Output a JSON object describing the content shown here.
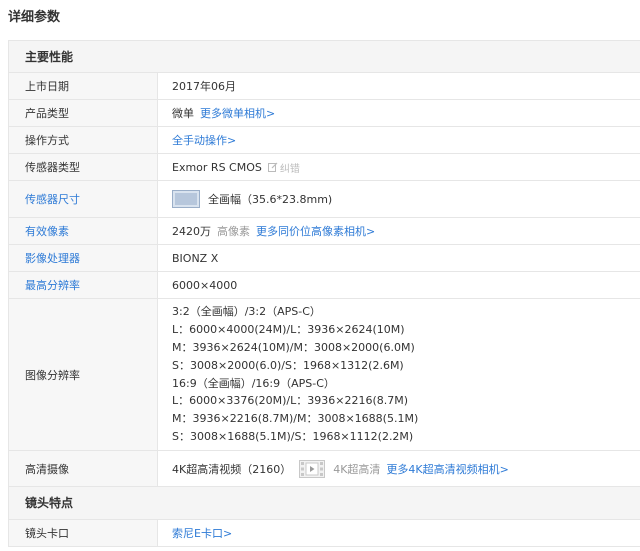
{
  "page_title": "详细参数",
  "sections": {
    "main": "主要性能",
    "lens": "镜头特点"
  },
  "rows": {
    "release_date": {
      "label": "上市日期",
      "value": "2017年06月"
    },
    "product_type": {
      "label": "产品类型",
      "value": "微单",
      "link": "更多微单相机>"
    },
    "operation": {
      "label": "操作方式",
      "link": "全手动操作>"
    },
    "sensor_type": {
      "label": "传感器类型",
      "value": "Exmor RS CMOS",
      "edit": "纠错"
    },
    "sensor_size": {
      "label": "传感器尺寸",
      "value": "全画幅（35.6*23.8mm)"
    },
    "effective_pixels": {
      "label": "有效像素",
      "value": "2420万",
      "note": "高像素",
      "link": "更多同价位高像素相机>"
    },
    "processor": {
      "label": "影像处理器",
      "value": "BIONZ X"
    },
    "max_resolution": {
      "label": "最高分辨率",
      "value": "6000×4000"
    },
    "image_resolution": {
      "label": "图像分辨率",
      "lines": [
        "3:2（全画幅）/3:2（APS-C）",
        "L：6000×4000(24M)/L：3936×2624(10M)",
        "M：3936×2624(10M)/M：3008×2000(6.0M)",
        "S：3008×2000(6.0)/S：1968×1312(2.6M)",
        "16:9（全画幅）/16:9（APS-C）",
        "L：6000×3376(20M)/L：3936×2216(8.7M)",
        "M：3936×2216(8.7M)/M：3008×1688(5.1M)",
        "S：3008×1688(5.1M)/S：1968×1112(2.2M)"
      ]
    },
    "hd_video": {
      "label": "高清摄像",
      "value": "4K超高清视频（2160）",
      "note": "4K超高清",
      "link": "更多4K超高清视频相机>"
    },
    "lens_mount": {
      "label": "镜头卡口",
      "link": "索尼E卡口>"
    }
  },
  "colors": {
    "link": "#2d7ad6",
    "border": "#e6e6e6",
    "label_bg": "#f7f7f7"
  }
}
